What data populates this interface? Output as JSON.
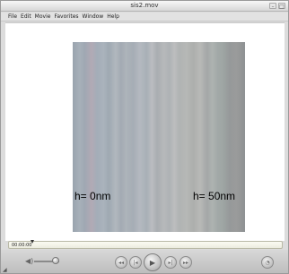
{
  "window": {
    "title": "sis2.mov",
    "controls": [
      "–",
      "□"
    ]
  },
  "menu": {
    "items": [
      "File",
      "Edit",
      "Movie",
      "Favorites",
      "Window",
      "Help"
    ]
  },
  "video": {
    "label_left": "h= 0nm",
    "label_right": "h= 50nm"
  },
  "timeline": {
    "timecode": "00:00:00"
  },
  "controls": {
    "volume_icon": "speaker-icon",
    "volume_level": 0.85,
    "buttons": [
      "◂◂",
      "|◂",
      "▶",
      "▸|",
      "▸▸",
      "◔"
    ]
  }
}
